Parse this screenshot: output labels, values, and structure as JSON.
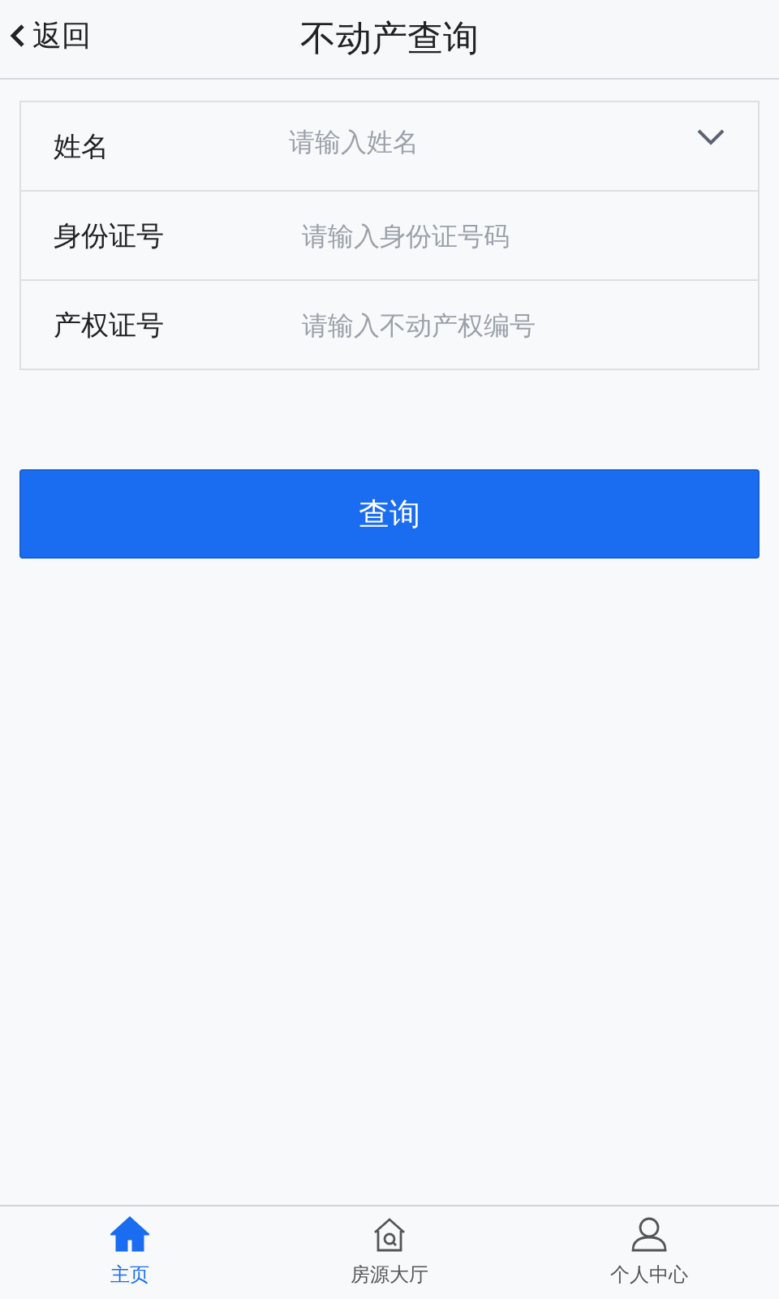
{
  "header": {
    "back": "返回",
    "title": "不动产查询"
  },
  "fields": [
    {
      "label": "姓名",
      "placeholder": "请输入姓名",
      "kind": "select"
    },
    {
      "label": "身份证号",
      "placeholder": "请输入身份证号码",
      "kind": "text"
    },
    {
      "label": "产权证号",
      "placeholder": "请输入不动产权编号",
      "kind": "text"
    }
  ],
  "submit": "查询",
  "tabs": [
    {
      "label": "主页",
      "selected": true
    },
    {
      "label": "房源大厅",
      "selected": false
    },
    {
      "label": "个人中心",
      "selected": false
    }
  ]
}
